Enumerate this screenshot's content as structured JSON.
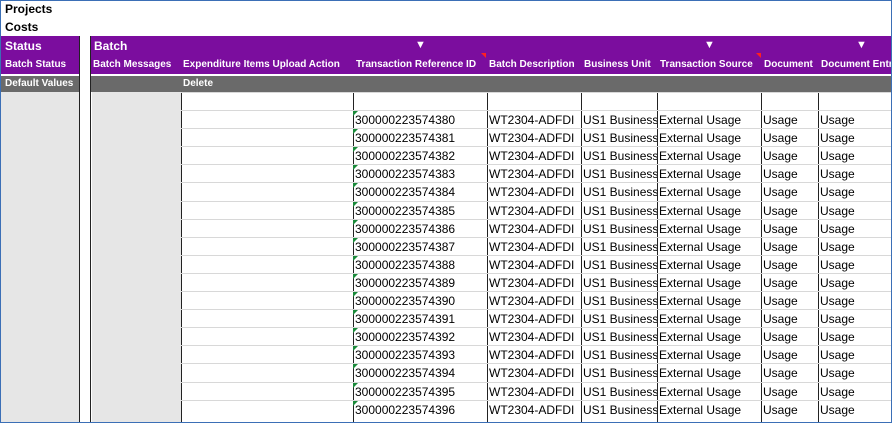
{
  "sheet": {
    "title1": "Projects",
    "title2": "Costs"
  },
  "header": {
    "group_status": "Status",
    "group_batch": "Batch",
    "filter_glyph": "▼",
    "columns": [
      "Batch Status",
      "Batch Messages",
      "Expenditure Items Upload Action",
      "Transaction Reference ID",
      "Batch Description",
      "Business Unit",
      "Transaction Source",
      "Document",
      "Document Entr"
    ]
  },
  "defaults": {
    "label": "Default Values",
    "action": "Delete"
  },
  "rows": [
    {
      "id": "300000223574380",
      "batch_desc": "WT2304-ADFDI",
      "bu": "US1 Business",
      "source": "External Usage",
      "doc": "Usage",
      "doc_entry": "Usage"
    },
    {
      "id": "300000223574381",
      "batch_desc": "WT2304-ADFDI",
      "bu": "US1 Business",
      "source": "External Usage",
      "doc": "Usage",
      "doc_entry": "Usage"
    },
    {
      "id": "300000223574382",
      "batch_desc": "WT2304-ADFDI",
      "bu": "US1 Business",
      "source": "External Usage",
      "doc": "Usage",
      "doc_entry": "Usage"
    },
    {
      "id": "300000223574383",
      "batch_desc": "WT2304-ADFDI",
      "bu": "US1 Business",
      "source": "External Usage",
      "doc": "Usage",
      "doc_entry": "Usage"
    },
    {
      "id": "300000223574384",
      "batch_desc": "WT2304-ADFDI",
      "bu": "US1 Business",
      "source": "External Usage",
      "doc": "Usage",
      "doc_entry": "Usage"
    },
    {
      "id": "300000223574385",
      "batch_desc": "WT2304-ADFDI",
      "bu": "US1 Business",
      "source": "External Usage",
      "doc": "Usage",
      "doc_entry": "Usage"
    },
    {
      "id": "300000223574386",
      "batch_desc": "WT2304-ADFDI",
      "bu": "US1 Business",
      "source": "External Usage",
      "doc": "Usage",
      "doc_entry": "Usage"
    },
    {
      "id": "300000223574387",
      "batch_desc": "WT2304-ADFDI",
      "bu": "US1 Business",
      "source": "External Usage",
      "doc": "Usage",
      "doc_entry": "Usage"
    },
    {
      "id": "300000223574388",
      "batch_desc": "WT2304-ADFDI",
      "bu": "US1 Business",
      "source": "External Usage",
      "doc": "Usage",
      "doc_entry": "Usage"
    },
    {
      "id": "300000223574389",
      "batch_desc": "WT2304-ADFDI",
      "bu": "US1 Business",
      "source": "External Usage",
      "doc": "Usage",
      "doc_entry": "Usage"
    },
    {
      "id": "300000223574390",
      "batch_desc": "WT2304-ADFDI",
      "bu": "US1 Business",
      "source": "External Usage",
      "doc": "Usage",
      "doc_entry": "Usage"
    },
    {
      "id": "300000223574391",
      "batch_desc": "WT2304-ADFDI",
      "bu": "US1 Business",
      "source": "External Usage",
      "doc": "Usage",
      "doc_entry": "Usage"
    },
    {
      "id": "300000223574392",
      "batch_desc": "WT2304-ADFDI",
      "bu": "US1 Business",
      "source": "External Usage",
      "doc": "Usage",
      "doc_entry": "Usage"
    },
    {
      "id": "300000223574393",
      "batch_desc": "WT2304-ADFDI",
      "bu": "US1 Business",
      "source": "External Usage",
      "doc": "Usage",
      "doc_entry": "Usage"
    },
    {
      "id": "300000223574394",
      "batch_desc": "WT2304-ADFDI",
      "bu": "US1 Business",
      "source": "External Usage",
      "doc": "Usage",
      "doc_entry": "Usage"
    },
    {
      "id": "300000223574395",
      "batch_desc": "WT2304-ADFDI",
      "bu": "US1 Business",
      "source": "External Usage",
      "doc": "Usage",
      "doc_entry": "Usage"
    },
    {
      "id": "300000223574396",
      "batch_desc": "WT2304-ADFDI",
      "bu": "US1 Business",
      "source": "External Usage",
      "doc": "Usage",
      "doc_entry": "Usage"
    }
  ],
  "colors": {
    "header_purple": "#7b0d9e",
    "band_gray": "#6a6a6a",
    "frame_blue": "#3b6fb6"
  }
}
